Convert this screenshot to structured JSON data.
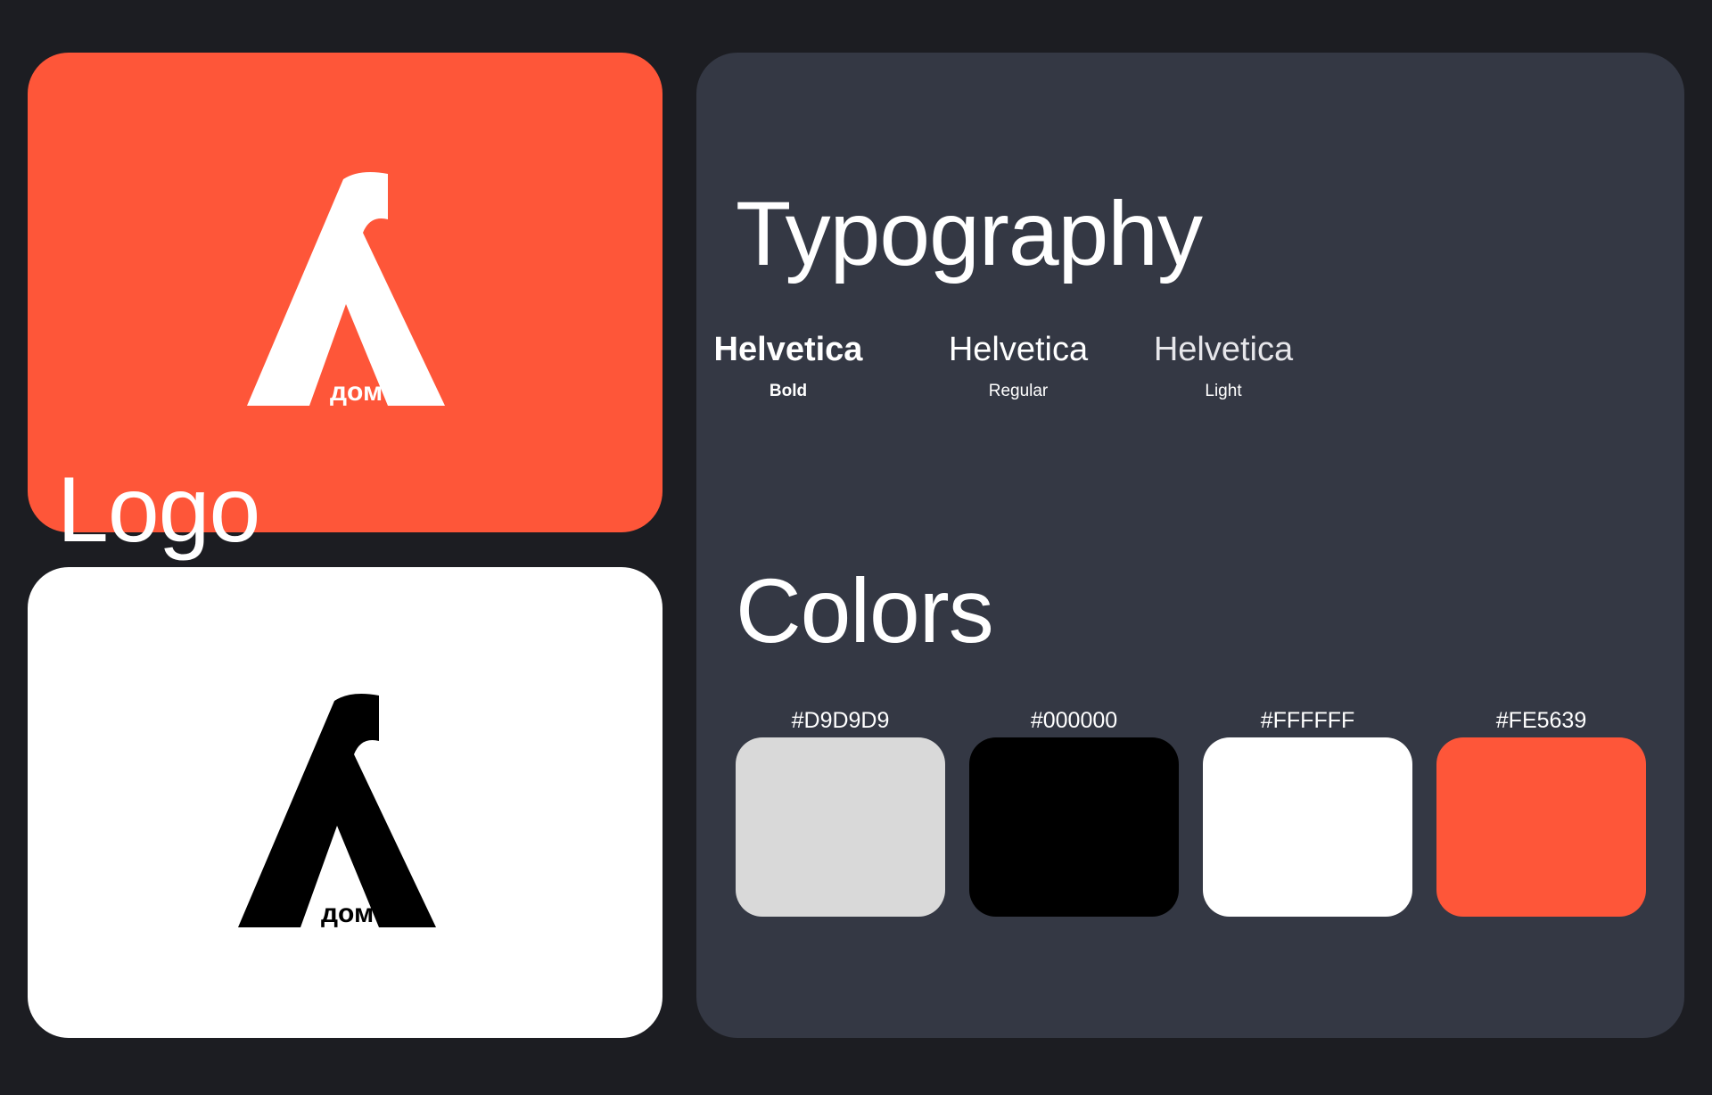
{
  "logo": {
    "title": "Logo",
    "wordmark": "дом",
    "primary_background": "#FE5639",
    "secondary_background": "#FFFFFF"
  },
  "typography": {
    "title": "Typography",
    "fonts": [
      {
        "name": "Helvetica",
        "weight": "Bold"
      },
      {
        "name": "Helvetica",
        "weight": "Regular"
      },
      {
        "name": "Helvetica",
        "weight": "Light"
      }
    ]
  },
  "colors": {
    "title": "Colors",
    "swatches": [
      {
        "hex": "#D9D9D9"
      },
      {
        "hex": "#000000"
      },
      {
        "hex": "#FFFFFF"
      },
      {
        "hex": "#FE5639"
      }
    ]
  }
}
